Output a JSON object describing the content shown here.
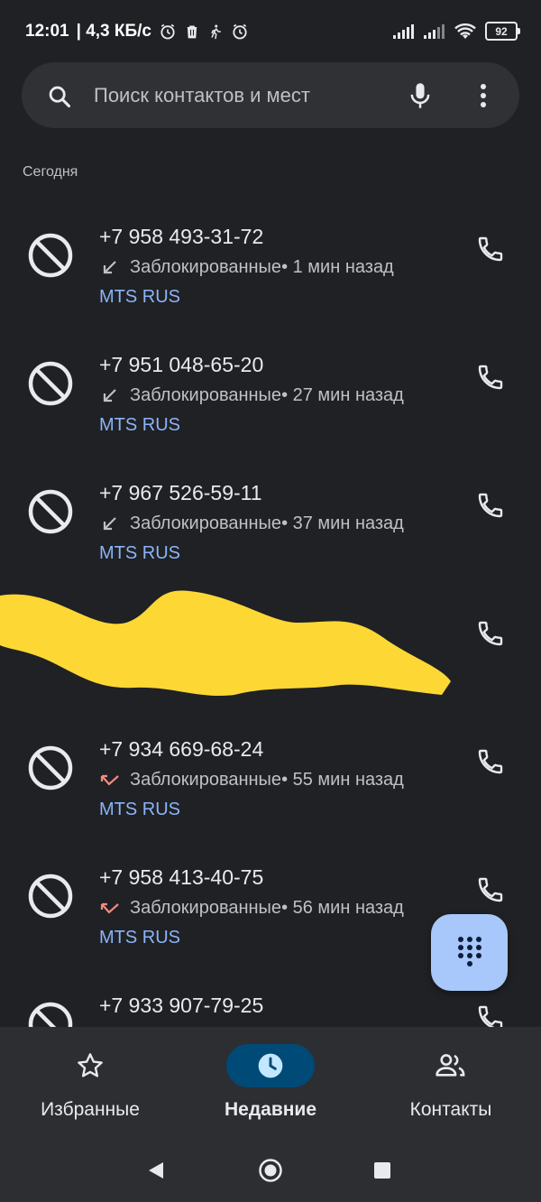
{
  "status_bar": {
    "time": "12:01",
    "speed": "| 4,3 КБ/с",
    "battery": "92"
  },
  "search": {
    "placeholder": "Поиск контактов и мест"
  },
  "section": {
    "today": "Сегодня"
  },
  "calls": [
    {
      "number": "+7 958 493-31-72",
      "status": "Заблокированные",
      "time": " • 1 мин назад",
      "carrier": "MTS RUS",
      "direction": "incoming"
    },
    {
      "number": "+7 951 048-65-20",
      "status": "Заблокированные",
      "time": " • 27 мин назад",
      "carrier": "MTS RUS",
      "direction": "incoming"
    },
    {
      "number": "+7 967 526-59-11",
      "status": "Заблокированные",
      "time": " • 37 мин назад",
      "carrier": "MTS RUS",
      "direction": "incoming"
    },
    {
      "number": "",
      "status": "",
      "time": "",
      "carrier": "",
      "direction": "redacted"
    },
    {
      "number": "+7 934 669-68-24",
      "status": "Заблокированные",
      "time": " • 55 мин назад",
      "carrier": "MTS RUS",
      "direction": "missed"
    },
    {
      "number": "+7 958 413-40-75",
      "status": "Заблокированные",
      "time": " • 56 мин назад",
      "carrier": "MTS RUS",
      "direction": "missed"
    },
    {
      "number": "+7 933 907-79-25",
      "status": "",
      "time": "",
      "carrier": "",
      "direction": "partial"
    }
  ],
  "bottom_nav": {
    "favorites": "Избранные",
    "recents": "Недавние",
    "contacts": "Контакты"
  },
  "colors": {
    "background": "#202124",
    "accent": "#8ab4f8",
    "fab": "#a8c7fa",
    "active_tab": "#004a77",
    "missed_arrow": "#f28b82",
    "scribble": "#fdd835"
  },
  "icons": {
    "search": "search-icon",
    "mic": "mic-icon",
    "more": "more-vert-icon",
    "blocked": "blocked-icon",
    "call": "phone-icon",
    "dialpad": "dialpad-icon"
  }
}
